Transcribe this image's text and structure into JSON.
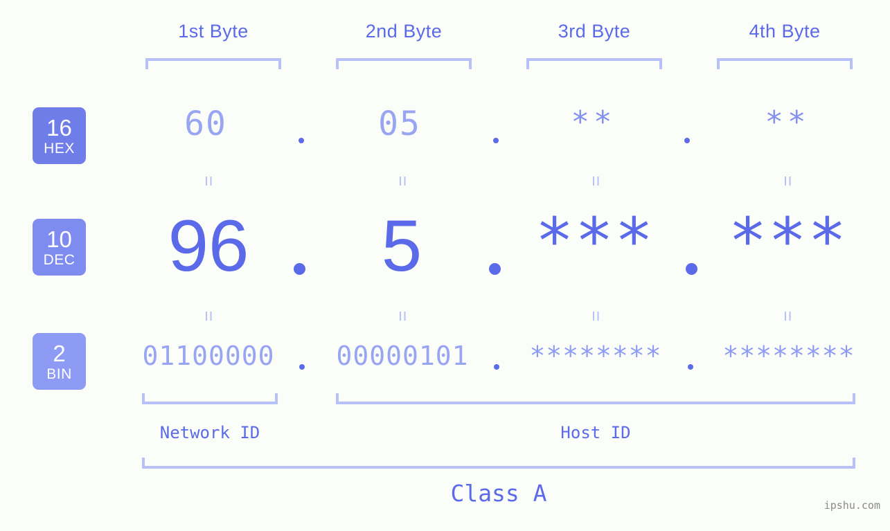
{
  "meta": {
    "watermark": "ipshu.com",
    "background_color": "#fbfdf8",
    "accent_color": "#5b6ae8",
    "accent_light_color": "#b7c0f7",
    "badge_colors": [
      "#6f7de9",
      "#7f8cef",
      "#8e9bf5"
    ]
  },
  "headers": {
    "byte1": "1st Byte",
    "byte2": "2nd Byte",
    "byte3": "3rd Byte",
    "byte4": "4th Byte"
  },
  "rows": {
    "hex": {
      "badge_number": "16",
      "badge_label": "HEX",
      "values": [
        "60",
        "05",
        "**",
        "**"
      ],
      "separator": "."
    },
    "dec": {
      "badge_number": "10",
      "badge_label": "DEC",
      "values": [
        "96",
        "5",
        "***",
        "***"
      ],
      "separator": "."
    },
    "bin": {
      "badge_number": "2",
      "badge_label": "BIN",
      "values": [
        "01100000",
        "00000101",
        "********",
        "********"
      ],
      "separator": "."
    }
  },
  "equals_marks": {
    "hex_to_dec": [
      "=",
      "=",
      "=",
      "="
    ],
    "dec_to_bin": [
      "=",
      "=",
      "=",
      "="
    ]
  },
  "sections": {
    "network_id": "Network ID",
    "host_id": "Host ID",
    "class": "Class A"
  }
}
